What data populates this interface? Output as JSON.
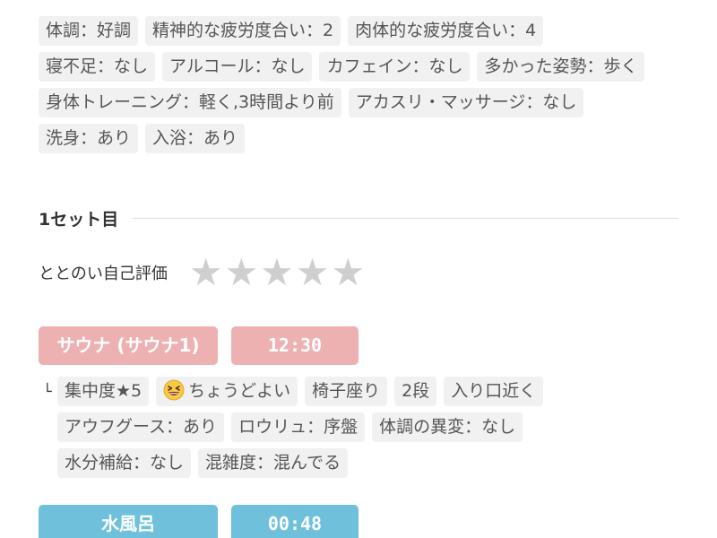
{
  "condition_tags": [
    [
      "体調：好調",
      "精神的な疲労度合い：2",
      "肉体的な疲労度合い：4"
    ],
    [
      "寝不足：なし",
      "アルコール：なし",
      "カフェイン：なし",
      "多かった姿勢：歩く"
    ],
    [
      "身体トレーニング：軽く,3時間より前",
      "アカスリ・マッサージ：なし"
    ],
    [
      "洗身：あり",
      "入浴：あり"
    ]
  ],
  "set": {
    "title": "1セット目",
    "rating_label": "ととのい自己評価",
    "rating_value": 0,
    "rating_max": 5
  },
  "sauna": {
    "name": "サウナ (サウナ1)",
    "time": "12:30",
    "color": "#eeb1b2",
    "branch_symbol": "└",
    "detail_rows": [
      [
        "集中度★5",
        "ちょうどよい",
        "椅子座り",
        "2段",
        "入り口近く"
      ],
      [
        "アウフグース：あり",
        "ロウリュ：序盤",
        "体調の異変：なし"
      ],
      [
        "水分補給：なし",
        "混雑度：混んでる"
      ]
    ],
    "emoji_icon": "grinning-squinting-face-icon"
  },
  "water": {
    "name": "水風呂",
    "time": "00:48",
    "color": "#6fc0db"
  },
  "colors": {
    "tag_background": "#f1f1f1",
    "star_inactive": "#cfcfcf"
  }
}
